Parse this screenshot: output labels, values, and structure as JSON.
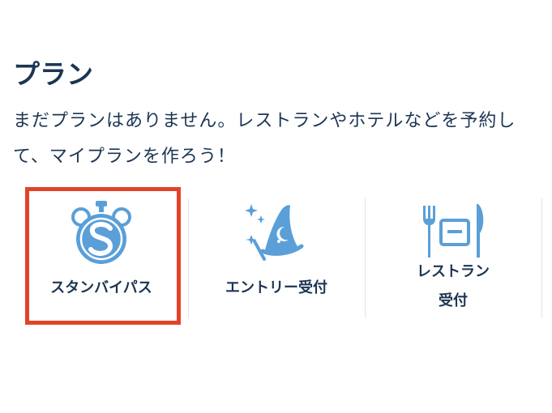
{
  "section": {
    "title": "プラン",
    "description": "まだプランはありません。レストランやホテルなどを予約して、マイプランを作ろう！"
  },
  "options": [
    {
      "label": "スタンバイパス",
      "icon": "standby-pass-icon"
    },
    {
      "label": "エントリー受付",
      "icon": "wizard-hat-icon"
    },
    {
      "label_line1": "レストラン",
      "label_line2": "受付",
      "icon": "restaurant-icon"
    }
  ],
  "colors": {
    "text": "#1c3553",
    "icon": "#5a9fd8",
    "highlight": "#e04428",
    "divider": "#e2e4e8"
  }
}
